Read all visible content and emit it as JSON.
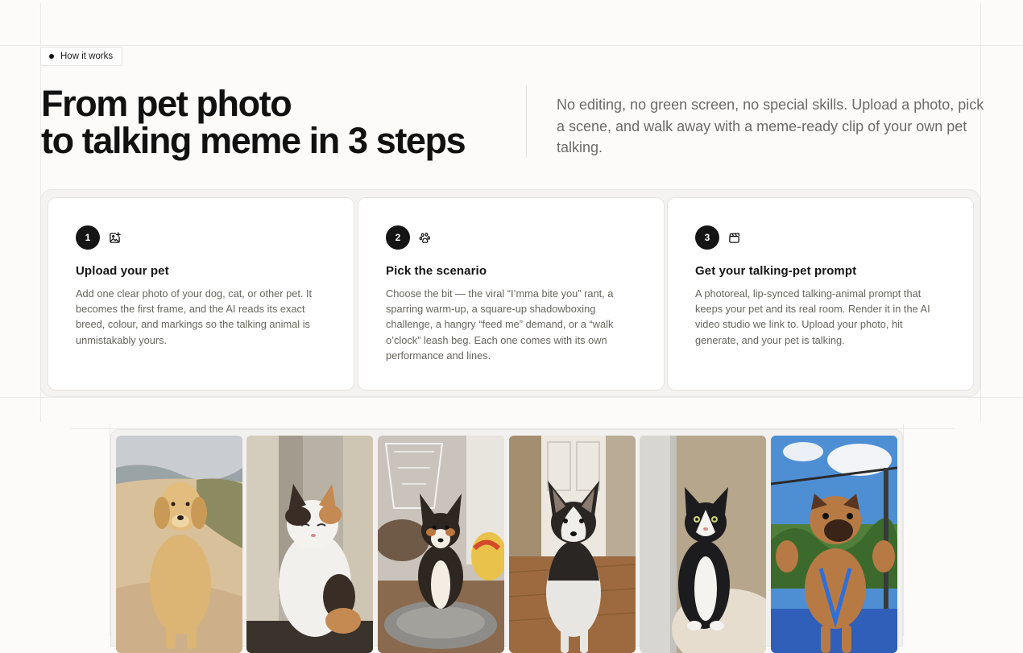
{
  "badge": {
    "label": "How it works"
  },
  "headline": {
    "line1": "From pet photo",
    "line2": "to talking meme in 3 steps"
  },
  "intro": "No editing, no green screen, no special skills. Upload a photo, pick a scene, and walk away with a meme-ready clip of your own pet talking.",
  "steps": [
    {
      "number": "1",
      "icon": "image-add-icon",
      "title": "Upload your pet",
      "body": "Add one clear photo of your dog, cat, or other pet. It becomes the first frame, and the AI reads its exact breed, colour, and markings so the talking animal is unmistakably yours."
    },
    {
      "number": "2",
      "icon": "paw-icon",
      "title": "Pick the scenario",
      "body": "Choose the bit — the viral “I’mma bite you” rant, a sparring warm-up, a square-up shadowboxing challenge, a hangry “feed me” demand, or a “walk o’clock” leash beg. Each one comes with its own performance and lines."
    },
    {
      "number": "3",
      "icon": "clapperboard-icon",
      "title": "Get your talking-pet prompt",
      "body": "A photoreal, lip-synced talking-animal prompt that keeps your pet and its real room. Render it in the AI video studio we link to. Upload your photo, hit generate, and your pet is talking."
    }
  ],
  "gallery": {
    "photos": [
      "golden-retriever-photo",
      "calico-cat-photo",
      "tricolor-corgi-mix-photo",
      "husky-photo",
      "tuxedo-cat-photo",
      "pug-boxing-photo"
    ]
  }
}
